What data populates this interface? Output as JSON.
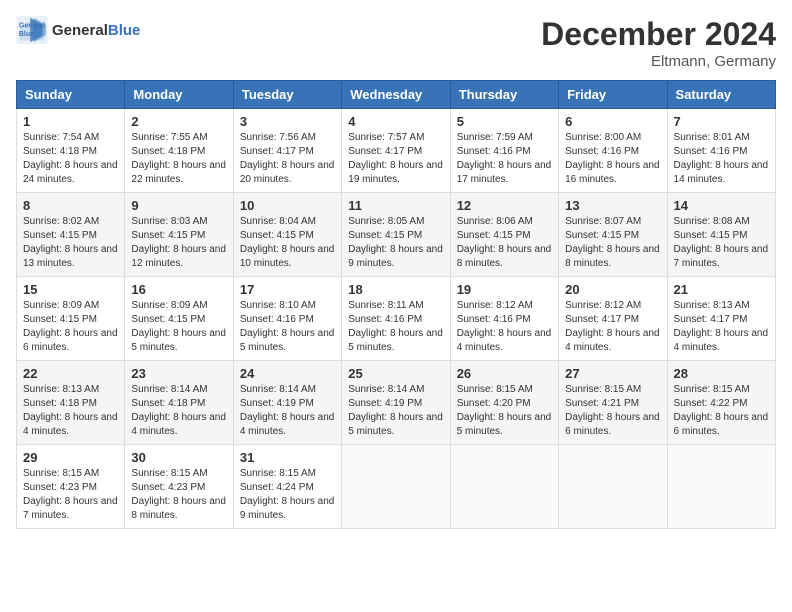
{
  "header": {
    "logo_line1": "General",
    "logo_line2": "Blue",
    "month_title": "December 2024",
    "location": "Eltmann, Germany"
  },
  "days_of_week": [
    "Sunday",
    "Monday",
    "Tuesday",
    "Wednesday",
    "Thursday",
    "Friday",
    "Saturday"
  ],
  "weeks": [
    [
      {
        "day": "1",
        "sunrise": "Sunrise: 7:54 AM",
        "sunset": "Sunset: 4:18 PM",
        "daylight": "Daylight: 8 hours and 24 minutes."
      },
      {
        "day": "2",
        "sunrise": "Sunrise: 7:55 AM",
        "sunset": "Sunset: 4:18 PM",
        "daylight": "Daylight: 8 hours and 22 minutes."
      },
      {
        "day": "3",
        "sunrise": "Sunrise: 7:56 AM",
        "sunset": "Sunset: 4:17 PM",
        "daylight": "Daylight: 8 hours and 20 minutes."
      },
      {
        "day": "4",
        "sunrise": "Sunrise: 7:57 AM",
        "sunset": "Sunset: 4:17 PM",
        "daylight": "Daylight: 8 hours and 19 minutes."
      },
      {
        "day": "5",
        "sunrise": "Sunrise: 7:59 AM",
        "sunset": "Sunset: 4:16 PM",
        "daylight": "Daylight: 8 hours and 17 minutes."
      },
      {
        "day": "6",
        "sunrise": "Sunrise: 8:00 AM",
        "sunset": "Sunset: 4:16 PM",
        "daylight": "Daylight: 8 hours and 16 minutes."
      },
      {
        "day": "7",
        "sunrise": "Sunrise: 8:01 AM",
        "sunset": "Sunset: 4:16 PM",
        "daylight": "Daylight: 8 hours and 14 minutes."
      }
    ],
    [
      {
        "day": "8",
        "sunrise": "Sunrise: 8:02 AM",
        "sunset": "Sunset: 4:15 PM",
        "daylight": "Daylight: 8 hours and 13 minutes."
      },
      {
        "day": "9",
        "sunrise": "Sunrise: 8:03 AM",
        "sunset": "Sunset: 4:15 PM",
        "daylight": "Daylight: 8 hours and 12 minutes."
      },
      {
        "day": "10",
        "sunrise": "Sunrise: 8:04 AM",
        "sunset": "Sunset: 4:15 PM",
        "daylight": "Daylight: 8 hours and 10 minutes."
      },
      {
        "day": "11",
        "sunrise": "Sunrise: 8:05 AM",
        "sunset": "Sunset: 4:15 PM",
        "daylight": "Daylight: 8 hours and 9 minutes."
      },
      {
        "day": "12",
        "sunrise": "Sunrise: 8:06 AM",
        "sunset": "Sunset: 4:15 PM",
        "daylight": "Daylight: 8 hours and 8 minutes."
      },
      {
        "day": "13",
        "sunrise": "Sunrise: 8:07 AM",
        "sunset": "Sunset: 4:15 PM",
        "daylight": "Daylight: 8 hours and 8 minutes."
      },
      {
        "day": "14",
        "sunrise": "Sunrise: 8:08 AM",
        "sunset": "Sunset: 4:15 PM",
        "daylight": "Daylight: 8 hours and 7 minutes."
      }
    ],
    [
      {
        "day": "15",
        "sunrise": "Sunrise: 8:09 AM",
        "sunset": "Sunset: 4:15 PM",
        "daylight": "Daylight: 8 hours and 6 minutes."
      },
      {
        "day": "16",
        "sunrise": "Sunrise: 8:09 AM",
        "sunset": "Sunset: 4:15 PM",
        "daylight": "Daylight: 8 hours and 5 minutes."
      },
      {
        "day": "17",
        "sunrise": "Sunrise: 8:10 AM",
        "sunset": "Sunset: 4:16 PM",
        "daylight": "Daylight: 8 hours and 5 minutes."
      },
      {
        "day": "18",
        "sunrise": "Sunrise: 8:11 AM",
        "sunset": "Sunset: 4:16 PM",
        "daylight": "Daylight: 8 hours and 5 minutes."
      },
      {
        "day": "19",
        "sunrise": "Sunrise: 8:12 AM",
        "sunset": "Sunset: 4:16 PM",
        "daylight": "Daylight: 8 hours and 4 minutes."
      },
      {
        "day": "20",
        "sunrise": "Sunrise: 8:12 AM",
        "sunset": "Sunset: 4:17 PM",
        "daylight": "Daylight: 8 hours and 4 minutes."
      },
      {
        "day": "21",
        "sunrise": "Sunrise: 8:13 AM",
        "sunset": "Sunset: 4:17 PM",
        "daylight": "Daylight: 8 hours and 4 minutes."
      }
    ],
    [
      {
        "day": "22",
        "sunrise": "Sunrise: 8:13 AM",
        "sunset": "Sunset: 4:18 PM",
        "daylight": "Daylight: 8 hours and 4 minutes."
      },
      {
        "day": "23",
        "sunrise": "Sunrise: 8:14 AM",
        "sunset": "Sunset: 4:18 PM",
        "daylight": "Daylight: 8 hours and 4 minutes."
      },
      {
        "day": "24",
        "sunrise": "Sunrise: 8:14 AM",
        "sunset": "Sunset: 4:19 PM",
        "daylight": "Daylight: 8 hours and 4 minutes."
      },
      {
        "day": "25",
        "sunrise": "Sunrise: 8:14 AM",
        "sunset": "Sunset: 4:19 PM",
        "daylight": "Daylight: 8 hours and 5 minutes."
      },
      {
        "day": "26",
        "sunrise": "Sunrise: 8:15 AM",
        "sunset": "Sunset: 4:20 PM",
        "daylight": "Daylight: 8 hours and 5 minutes."
      },
      {
        "day": "27",
        "sunrise": "Sunrise: 8:15 AM",
        "sunset": "Sunset: 4:21 PM",
        "daylight": "Daylight: 8 hours and 6 minutes."
      },
      {
        "day": "28",
        "sunrise": "Sunrise: 8:15 AM",
        "sunset": "Sunset: 4:22 PM",
        "daylight": "Daylight: 8 hours and 6 minutes."
      }
    ],
    [
      {
        "day": "29",
        "sunrise": "Sunrise: 8:15 AM",
        "sunset": "Sunset: 4:23 PM",
        "daylight": "Daylight: 8 hours and 7 minutes."
      },
      {
        "day": "30",
        "sunrise": "Sunrise: 8:15 AM",
        "sunset": "Sunset: 4:23 PM",
        "daylight": "Daylight: 8 hours and 8 minutes."
      },
      {
        "day": "31",
        "sunrise": "Sunrise: 8:15 AM",
        "sunset": "Sunset: 4:24 PM",
        "daylight": "Daylight: 8 hours and 9 minutes."
      },
      null,
      null,
      null,
      null
    ]
  ]
}
